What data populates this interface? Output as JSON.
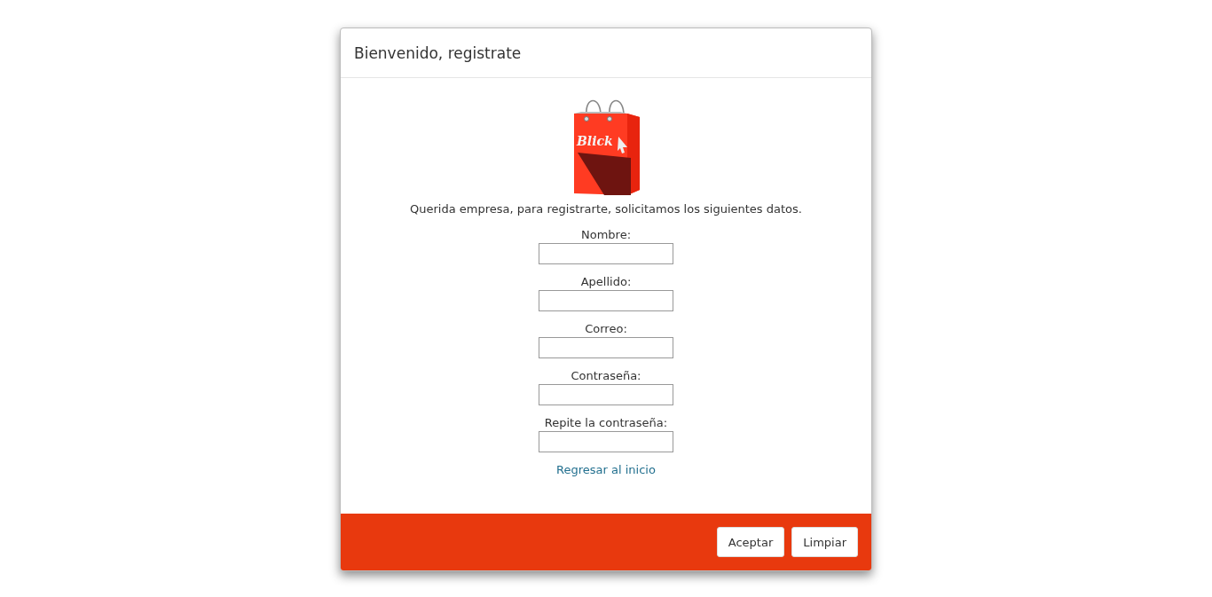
{
  "dialog": {
    "title": "Bienvenido, registrate"
  },
  "logo": {
    "text": "Blick"
  },
  "intro": "Querida empresa, para registrarte, solicitamos los siguientes datos.",
  "fields": [
    {
      "label": "Nombre:"
    },
    {
      "label": "Apellido:"
    },
    {
      "label": "Correo:"
    },
    {
      "label": "Contraseña:"
    },
    {
      "label": "Repite la contraseña:"
    }
  ],
  "link": "Regresar al inicio",
  "buttons": [
    "Aceptar",
    "Limpiar"
  ]
}
